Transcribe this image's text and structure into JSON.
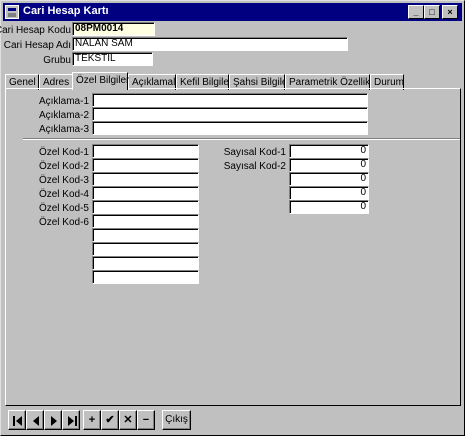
{
  "window": {
    "title": "Cari Hesap Kartı",
    "controls": {
      "minimize": "_",
      "maximize": "□",
      "close": "×"
    }
  },
  "header": {
    "kod_label": "Cari Hesap Kodu",
    "kod_value": "08PM0014",
    "adi_label": "Cari Hesap Adı",
    "adi_value": "NALAN SAM",
    "grup_label": "Grubu",
    "grup_value": "TEKSTİL"
  },
  "tabs": [
    {
      "label": "Genel"
    },
    {
      "label": "Adres"
    },
    {
      "label": "Özel Bilgiler",
      "active": true
    },
    {
      "label": "Açıklamalar"
    },
    {
      "label": "Kefil Bilgileri"
    },
    {
      "label": "Şahsi Bilgiler"
    },
    {
      "label": "Parametrik Özellikler"
    },
    {
      "label": "Durum"
    }
  ],
  "aciklama": {
    "labels": [
      "Açıklama-1",
      "Açıklama-2",
      "Açıklama-3"
    ],
    "values": [
      "",
      "",
      ""
    ]
  },
  "ozel_kod": {
    "labels": [
      "Özel Kod-1",
      "Özel Kod-2",
      "Özel Kod-3",
      "Özel Kod-4",
      "Özel Kod-5",
      "Özel Kod-6"
    ],
    "values": [
      "",
      "",
      "",
      "",
      "",
      "",
      "",
      "",
      "",
      ""
    ]
  },
  "sayisal_kod": {
    "labels": [
      "Sayısal Kod-1",
      "Sayısal Kod-2"
    ],
    "values": [
      "0",
      "0",
      "0",
      "0",
      "0"
    ]
  },
  "toolbar": {
    "icons": [
      "first-record-icon",
      "prior-record-icon",
      "next-record-icon",
      "last-record-icon",
      "insert-icon",
      "post-icon",
      "cancel-icon",
      "delete-icon"
    ],
    "insert_glyph": "+",
    "post_glyph": "✔",
    "cancel_glyph": "✕",
    "delete_glyph": "−",
    "exit_label": "Çıkış"
  }
}
